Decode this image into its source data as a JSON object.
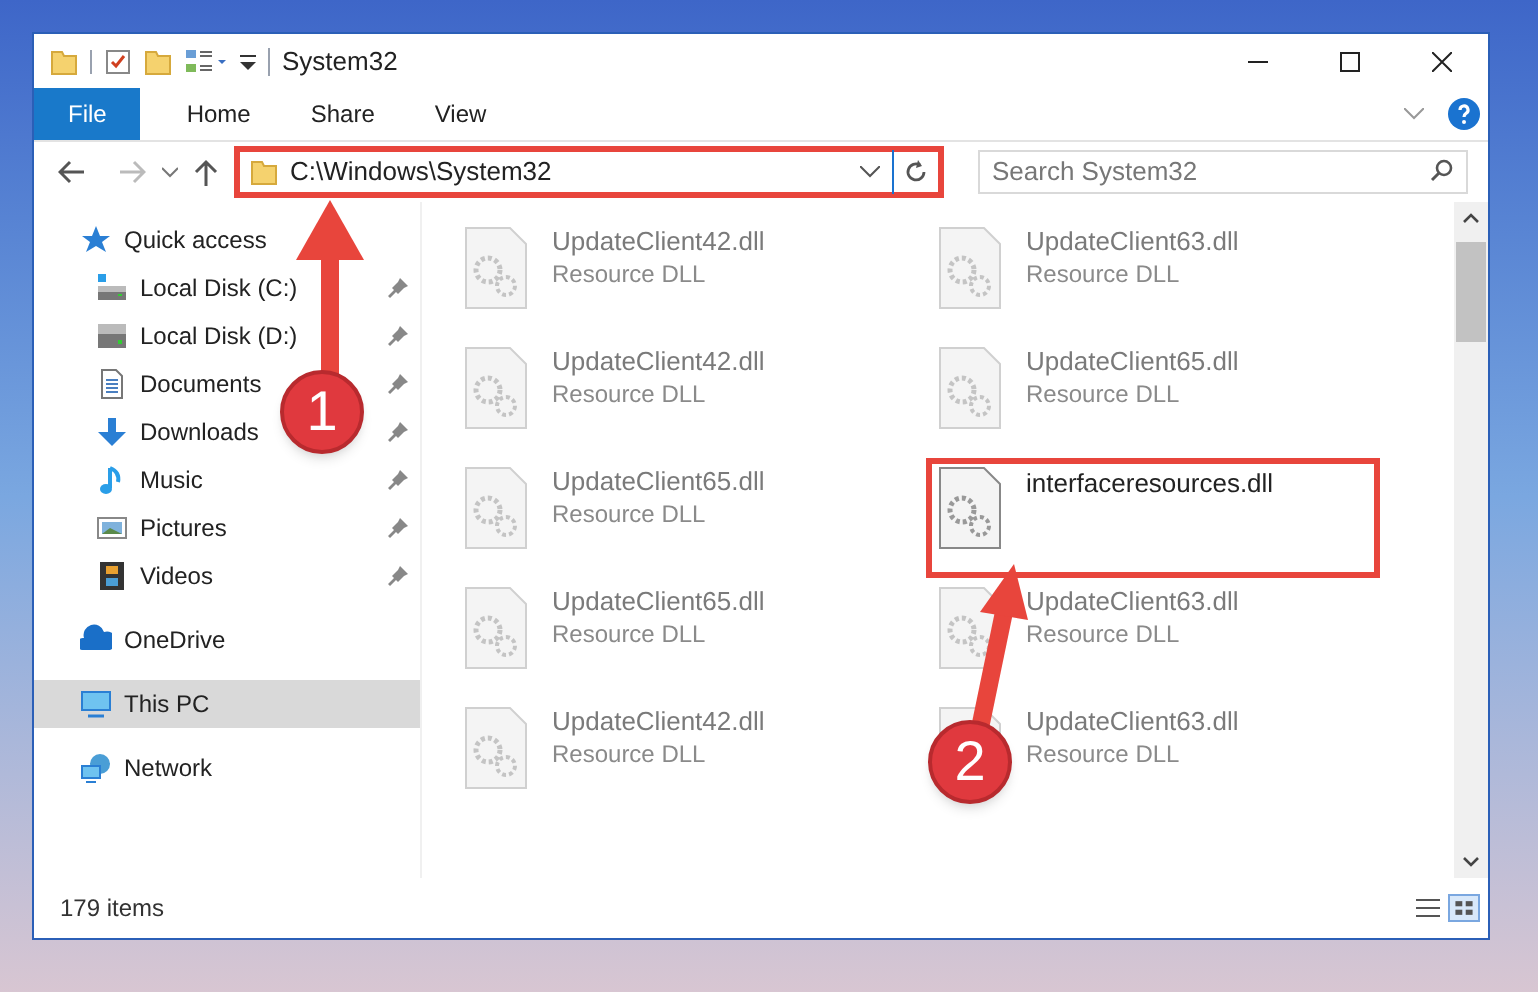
{
  "window": {
    "title": "System32"
  },
  "ribbon_tabs": [
    {
      "label": "File",
      "selected": true
    },
    {
      "label": "Home",
      "selected": false
    },
    {
      "label": "Share",
      "selected": false
    },
    {
      "label": "View",
      "selected": false
    }
  ],
  "address": {
    "path": "C:\\Windows\\System32",
    "highlighted": true
  },
  "search": {
    "placeholder": "Search System32"
  },
  "navigation": [
    {
      "label": "Quick access",
      "kind": "star",
      "selected": false,
      "children": [
        {
          "label": "Local Disk (C:)",
          "kind": "system_drive",
          "pinned": true
        },
        {
          "label": "Local Disk (D:)",
          "kind": "drive",
          "pinned": true
        },
        {
          "label": "Documents",
          "kind": "document",
          "pinned": true
        },
        {
          "label": "Downloads",
          "kind": "download",
          "pinned": true
        },
        {
          "label": "Music",
          "kind": "music",
          "pinned": true
        },
        {
          "label": "Pictures",
          "kind": "picture",
          "pinned": true
        },
        {
          "label": "Videos",
          "kind": "film",
          "pinned": true
        }
      ]
    },
    {
      "label": "OneDrive",
      "kind": "cloud",
      "selected": false
    },
    {
      "label": "This PC",
      "kind": "monitor",
      "selected": true
    },
    {
      "label": "Network",
      "kind": "network",
      "selected": false
    }
  ],
  "files": [
    {
      "name": "UpdateClient42.dll",
      "type": "Resource DLL",
      "blurred": true,
      "highlighted": false
    },
    {
      "name": "UpdateClient63.dll",
      "type": "Resource DLL",
      "blurred": true,
      "highlighted": false
    },
    {
      "name": "UpdateClient42.dll",
      "type": "Resource DLL",
      "blurred": true,
      "highlighted": false
    },
    {
      "name": "UpdateClient65.dll",
      "type": "Resource DLL",
      "blurred": true,
      "highlighted": false
    },
    {
      "name": "UpdateClient65.dll",
      "type": "Resource DLL",
      "blurred": true,
      "highlighted": false
    },
    {
      "name": "interfaceresources.dll",
      "blurred": false,
      "highlighted": true
    },
    {
      "name": "UpdateClient65.dll",
      "type": "Resource DLL",
      "blurred": true,
      "highlighted": false
    },
    {
      "name": "UpdateClient63.dll",
      "type": "Resource DLL",
      "blurred": true,
      "highlighted": false
    },
    {
      "name": "UpdateClient42.dll",
      "type": "Resource DLL",
      "blurred": true,
      "highlighted": false
    },
    {
      "name": "UpdateClient63.dll",
      "type": "Resource DLL",
      "blurred": true,
      "highlighted": false
    }
  ],
  "status_bar": {
    "item_count": "179 items"
  },
  "callouts": [
    {
      "number": "1"
    },
    {
      "number": "2"
    }
  ]
}
